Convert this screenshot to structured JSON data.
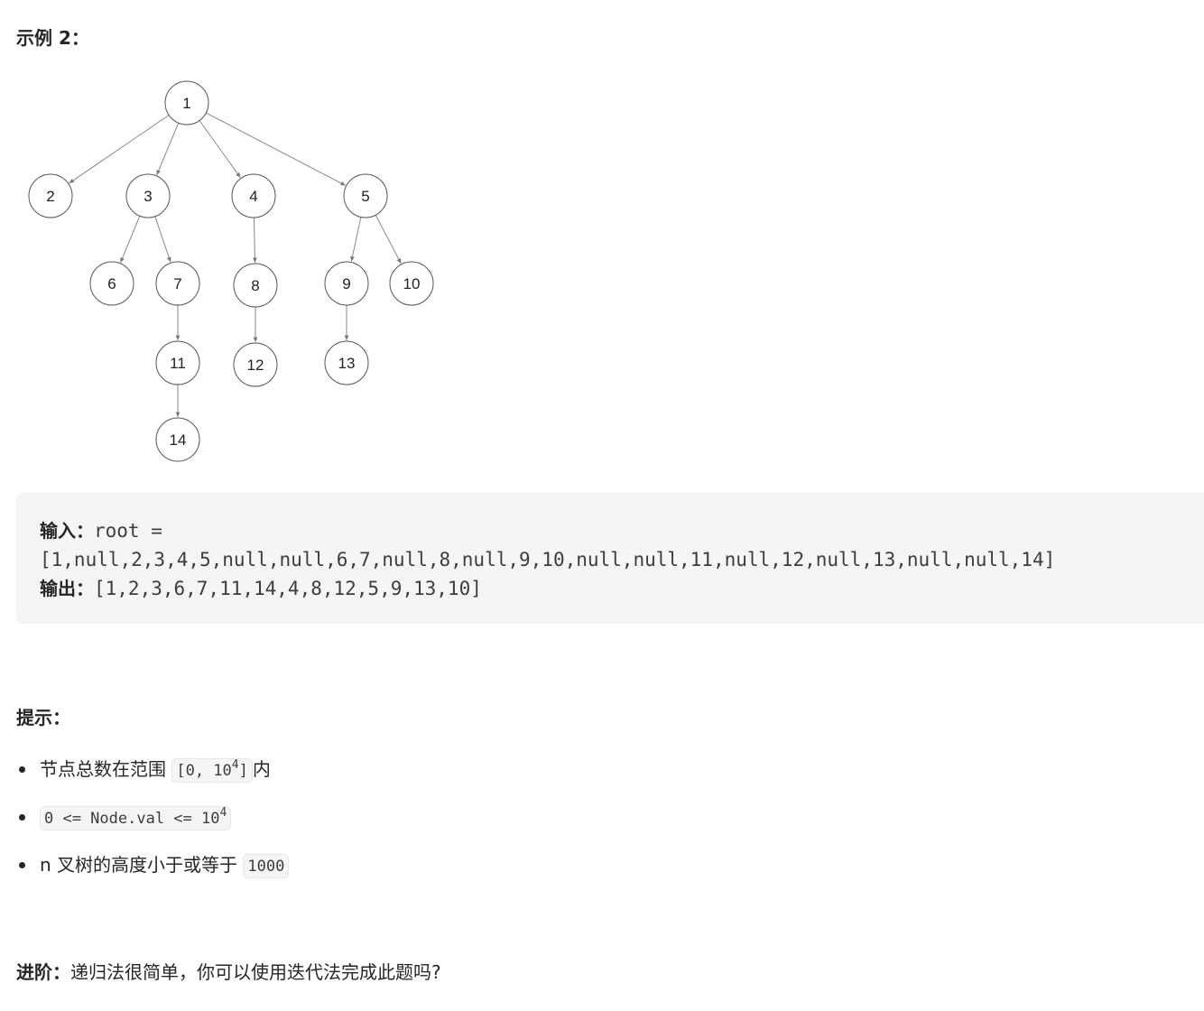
{
  "example": {
    "heading": "示例 2："
  },
  "tree": {
    "nodes": [
      {
        "label": "1"
      },
      {
        "label": "2"
      },
      {
        "label": "3"
      },
      {
        "label": "4"
      },
      {
        "label": "5"
      },
      {
        "label": "6"
      },
      {
        "label": "7"
      },
      {
        "label": "8"
      },
      {
        "label": "9"
      },
      {
        "label": "10"
      },
      {
        "label": "11"
      },
      {
        "label": "12"
      },
      {
        "label": "13"
      },
      {
        "label": "14"
      }
    ],
    "edges": [
      [
        "1",
        "2"
      ],
      [
        "1",
        "3"
      ],
      [
        "1",
        "4"
      ],
      [
        "1",
        "5"
      ],
      [
        "3",
        "6"
      ],
      [
        "3",
        "7"
      ],
      [
        "4",
        "8"
      ],
      [
        "5",
        "9"
      ],
      [
        "5",
        "10"
      ],
      [
        "7",
        "11"
      ],
      [
        "8",
        "12"
      ],
      [
        "9",
        "13"
      ],
      [
        "11",
        "14"
      ]
    ]
  },
  "io": {
    "input_label": "输入：",
    "input_prefix": "root =",
    "input_value": "[1,null,2,3,4,5,null,null,6,7,null,8,null,9,10,null,null,11,null,12,null,13,null,null,14]",
    "output_label": "输出：",
    "output_value": "[1,2,3,6,7,11,14,4,8,12,5,9,13,10]"
  },
  "constraints": {
    "title": "提示：",
    "item1_text": "节点总数在范围 ",
    "item1_code": "[0, 10",
    "item1_sup": "4",
    "item1_code_end": "]",
    "item1_suffix": "内",
    "item2_code": "0 <= Node.val <= 10",
    "item2_sup": "4",
    "item3_text": "n 叉树的高度小于或等于 ",
    "item3_code": "1000"
  },
  "followup": {
    "label": "进阶：",
    "text": "递归法很简单，你可以使用迭代法完成此题吗?"
  },
  "colors": {
    "text": "#262626",
    "code_bg": "#f5f5f5",
    "node_stroke": "#555555",
    "edge": "#888888"
  }
}
